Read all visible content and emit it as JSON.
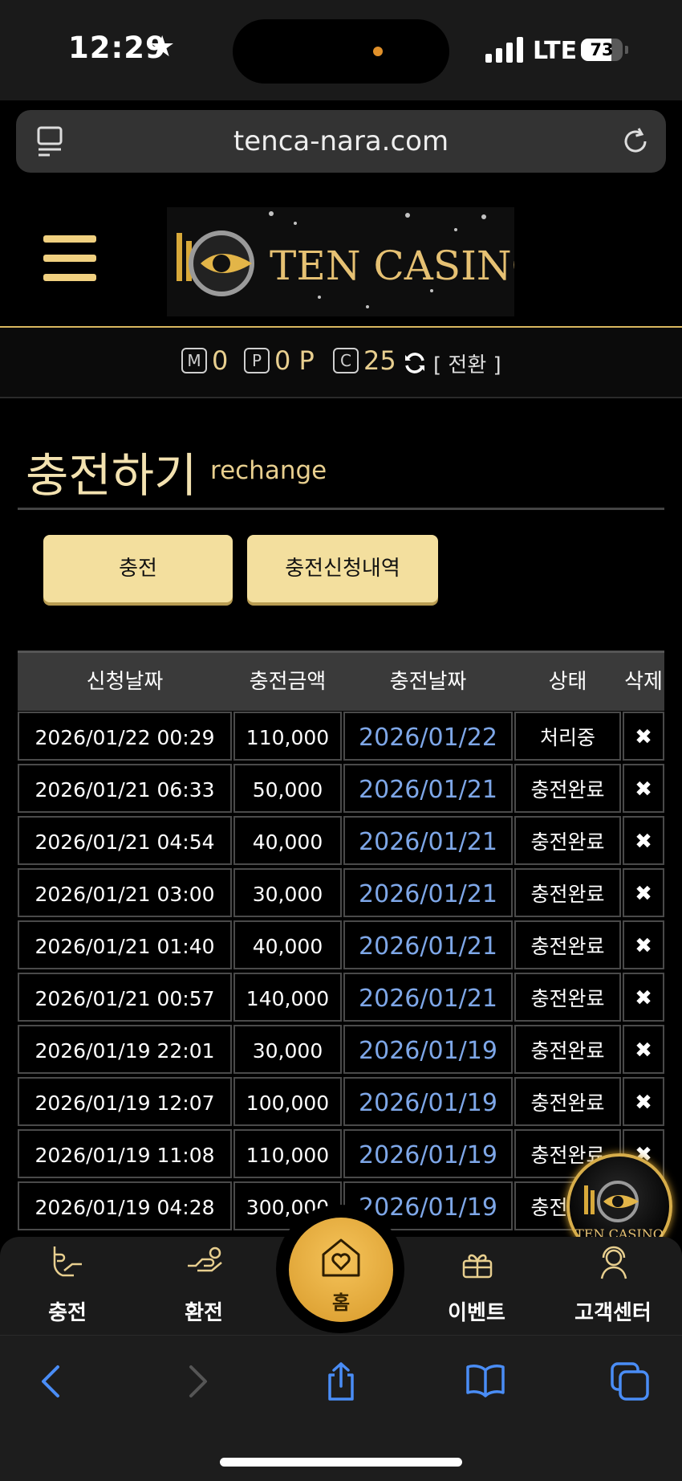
{
  "status_bar": {
    "time": "12:29",
    "network": "LTE",
    "battery": "73",
    "battery_fraction": 0.73
  },
  "browser": {
    "url": "tenca-nara.com"
  },
  "site": {
    "logo_text": "TEN CASINO"
  },
  "points": {
    "m_badge": "M",
    "m_value": "0",
    "p_badge": "P",
    "p_value": "0 P",
    "c_badge": "C",
    "c_value": "25",
    "switch_label": "[ 전환 ]"
  },
  "heading": {
    "title": "충전하기",
    "subtitle": "rechange"
  },
  "buttons": {
    "charge": "충전",
    "history": "충전신청내역"
  },
  "table": {
    "headers": [
      "신청날짜",
      "충전금액",
      "충전날짜",
      "상태",
      "삭제"
    ],
    "rows": [
      {
        "req": "2026/01/22 00:29",
        "amount": "110,000",
        "date": "2026/01/22",
        "status": "처리중",
        "del": "✖"
      },
      {
        "req": "2026/01/21 06:33",
        "amount": "50,000",
        "date": "2026/01/21",
        "status": "충전완료",
        "del": "✖"
      },
      {
        "req": "2026/01/21 04:54",
        "amount": "40,000",
        "date": "2026/01/21",
        "status": "충전완료",
        "del": "✖"
      },
      {
        "req": "2026/01/21 03:00",
        "amount": "30,000",
        "date": "2026/01/21",
        "status": "충전완료",
        "del": "✖"
      },
      {
        "req": "2026/01/21 01:40",
        "amount": "40,000",
        "date": "2026/01/21",
        "status": "충전완료",
        "del": "✖"
      },
      {
        "req": "2026/01/21 00:57",
        "amount": "140,000",
        "date": "2026/01/21",
        "status": "충전완료",
        "del": "✖"
      },
      {
        "req": "2026/01/19 22:01",
        "amount": "30,000",
        "date": "2026/01/19",
        "status": "충전완료",
        "del": "✖"
      },
      {
        "req": "2026/01/19 12:07",
        "amount": "100,000",
        "date": "2026/01/19",
        "status": "충전완료",
        "del": "✖"
      },
      {
        "req": "2026/01/19 11:08",
        "amount": "110,000",
        "date": "2026/01/19",
        "status": "충전완료",
        "del": "✖"
      },
      {
        "req": "2026/01/19 04:28",
        "amount": "300,000",
        "date": "2026/01/19",
        "status": "충전완료",
        "del": "✖"
      }
    ]
  },
  "fab": {
    "text": "TEN CASINO"
  },
  "bottom_nav": {
    "charge": "충전",
    "withdraw": "환전",
    "home": "홈",
    "event": "이벤트",
    "support": "고객센터"
  },
  "colors": {
    "gold": "#e8cf8f",
    "button": "#f3df9e",
    "link_blue": "#7ea7e8",
    "accent_orange": "#f5c35a"
  }
}
